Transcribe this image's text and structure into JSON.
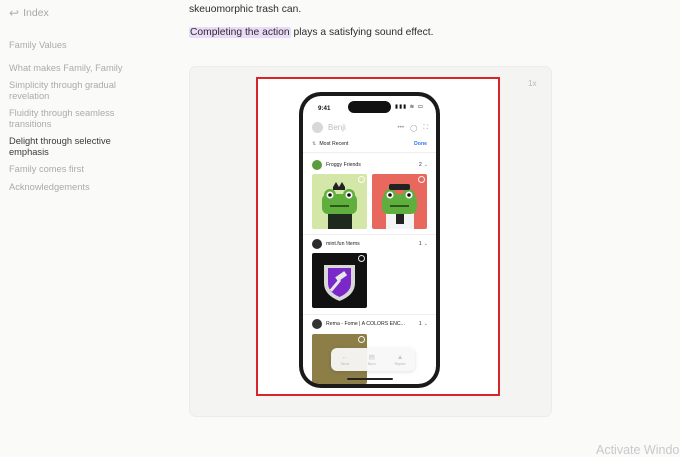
{
  "sidebar": {
    "back_label": "Index",
    "items": [
      {
        "label": "Family Values",
        "active": false
      },
      {
        "label": "What makes Family, Family",
        "active": false
      },
      {
        "label": "Simplicity through gradual revelation",
        "active": false
      },
      {
        "label": "Fluidity through seamless transitions",
        "active": false
      },
      {
        "label": "Delight through selective emphasis",
        "active": true
      },
      {
        "label": "Family comes first",
        "active": false
      },
      {
        "label": "Acknowledgements",
        "active": false
      }
    ]
  },
  "article": {
    "line1": "skeuomorphic trash can.",
    "line2_highlight": "Completing the action",
    "line2_rest": " plays a satisfying sound effect."
  },
  "demo": {
    "speed": "1x",
    "phone": {
      "time": "9:41",
      "status_icons": "▮▮▮ ≋ ▭",
      "profile_name": "Benji",
      "sort_label": "Most Recent",
      "done_label": "Done",
      "groups": [
        {
          "name": "Froggy Friends",
          "count": "2"
        },
        {
          "name": "mint.fun !items",
          "count": "1"
        },
        {
          "name": "Rema - Fome | A COLORS ENC...",
          "count": "1"
        }
      ],
      "toolbar": [
        {
          "label": "Send",
          "icon": "send-icon"
        },
        {
          "label": "Burn",
          "icon": "trash-icon"
        },
        {
          "label": "Report",
          "icon": "warning-icon"
        }
      ]
    }
  },
  "watermark": "Activate Windo",
  "colors": {
    "highlight": "#eadcf8",
    "red_box": "#d6262c",
    "done_blue": "#2f7bea",
    "frog_tile_1": "#d4e7a8",
    "frog_tile_2": "#e8685e",
    "shield_purple": "#7a28c8"
  }
}
